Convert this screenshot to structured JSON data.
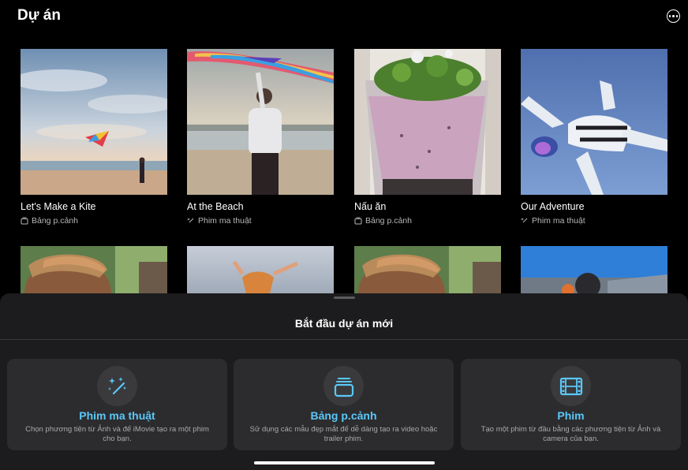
{
  "header": {
    "title": "Dự án",
    "more_icon": "ellipsis-circle-icon"
  },
  "projects": [
    {
      "title": "Let's Make a Kite",
      "type": "Bảng p.cảnh",
      "type_icon": "storyboard-icon",
      "thumb": "kite on beach at sunset"
    },
    {
      "title": "At the Beach",
      "type": "Phim ma thuật",
      "type_icon": "magic-wand-icon",
      "thumb": "person holding rainbow kite"
    },
    {
      "title": "Nấu ăn",
      "type": "Bảng p.cảnh",
      "type_icon": "storyboard-icon",
      "thumb": "green smoothie in blender"
    },
    {
      "title": "Our Adventure",
      "type": "Phim ma thuật",
      "type_icon": "magic-wand-icon",
      "thumb": "skydiver in blue sky"
    }
  ],
  "sheet": {
    "title": "Bắt đầu dự án mới",
    "options": [
      {
        "title": "Phim ma thuật",
        "desc": "Chọn phương tiện từ Ảnh và để iMovie tạo ra một phim cho bạn.",
        "icon": "magic-wand-icon"
      },
      {
        "title": "Bảng p.cảnh",
        "desc": "Sử dụng các mẫu đẹp mắt để dễ dàng tạo ra video hoặc trailer phim.",
        "icon": "storyboard-icon"
      },
      {
        "title": "Phim",
        "desc": "Tạo một phim từ đầu bằng các phương tiện từ Ảnh và camera của bạn.",
        "icon": "film-icon"
      }
    ]
  },
  "colors": {
    "accent": "#5ac8fa",
    "sheet_bg": "#1c1c1e",
    "card_bg": "#2c2c2e"
  }
}
